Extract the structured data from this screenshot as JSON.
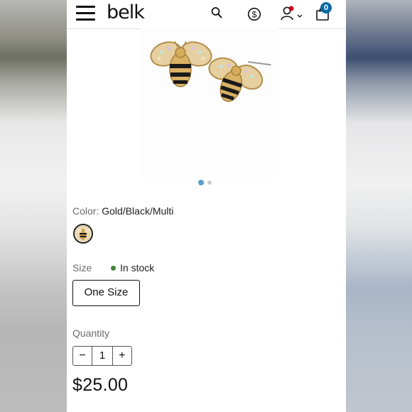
{
  "header": {
    "logo": "belk",
    "cart_count": "0",
    "icons": [
      "menu-icon",
      "search-icon",
      "dollar-icon",
      "account-icon",
      "chevron-down-icon",
      "cart-icon"
    ]
  },
  "product": {
    "image": "gold bee stud earrings with black stripes and crystals",
    "image_count": 2,
    "active_image_index": 1,
    "color_label": "Color:",
    "color_value": "Gold/Black/Multi",
    "size_label": "Size",
    "stock_status": "In stock",
    "size_option": "One Size",
    "quantity_label": "Quantity",
    "quantity": "1",
    "decrement": "−",
    "increment": "+",
    "price": "$25.00"
  },
  "colors": {
    "stock_green": "#3d8b37",
    "cart_badge": "#0a6aa6",
    "active_dot": "#5b9fd0",
    "inactive_dot": "#cccccc",
    "notification_dot": "#d0021b"
  }
}
